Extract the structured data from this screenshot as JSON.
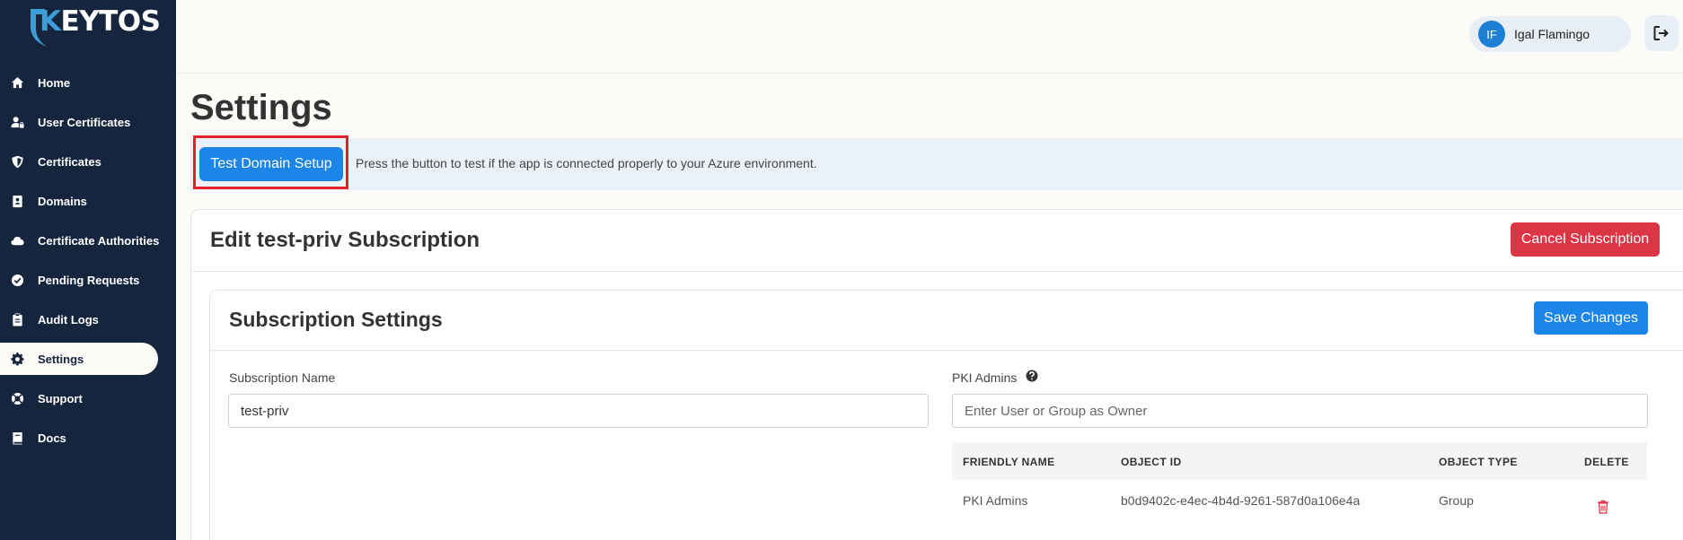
{
  "brand": {
    "logo_text_k": "K",
    "logo_text_rest": "EYTOS",
    "accent": "#3f9cd6"
  },
  "sidebar": {
    "items": [
      {
        "label": "Home",
        "icon": "home-icon"
      },
      {
        "label": "User Certificates",
        "icon": "user-lock-icon"
      },
      {
        "label": "Certificates",
        "icon": "shield-icon"
      },
      {
        "label": "Domains",
        "icon": "address-book-icon"
      },
      {
        "label": "Certificate Authorities",
        "icon": "cloud-icon"
      },
      {
        "label": "Pending Requests",
        "icon": "check-circle-icon"
      },
      {
        "label": "Audit Logs",
        "icon": "clipboard-icon"
      },
      {
        "label": "Settings",
        "icon": "gear-icon",
        "active": true
      },
      {
        "label": "Support",
        "icon": "lifebuoy-icon"
      },
      {
        "label": "Docs",
        "icon": "book-icon"
      }
    ]
  },
  "header": {
    "user": {
      "initials": "IF",
      "name": "Igal Flamingo"
    }
  },
  "page": {
    "title": "Settings",
    "test_button_label": "Test Domain Setup",
    "test_description": "Press the button to test if the app is connected properly to your Azure environment."
  },
  "edit": {
    "title": "Edit test-priv Subscription",
    "cancel_label": "Cancel Subscription"
  },
  "subscription": {
    "title": "Subscription Settings",
    "save_label": "Save Changes",
    "name_label": "Subscription Name",
    "name_value": "test-priv",
    "admins_label": "PKI Admins",
    "admins_placeholder": "Enter User or Group as Owner",
    "table": {
      "headers": [
        "FRIENDLY NAME",
        "OBJECT ID",
        "OBJECT TYPE",
        "DELETE"
      ],
      "rows": [
        {
          "friendly_name": "PKI Admins",
          "object_id": "b0d9402c-e4ec-4b4d-9261-587d0a106e4a",
          "object_type": "Group"
        }
      ]
    }
  },
  "colors": {
    "sidebar_bg": "#14253d",
    "primary": "#1c85e8",
    "danger": "#dc3545",
    "highlight": "#e0202a"
  }
}
